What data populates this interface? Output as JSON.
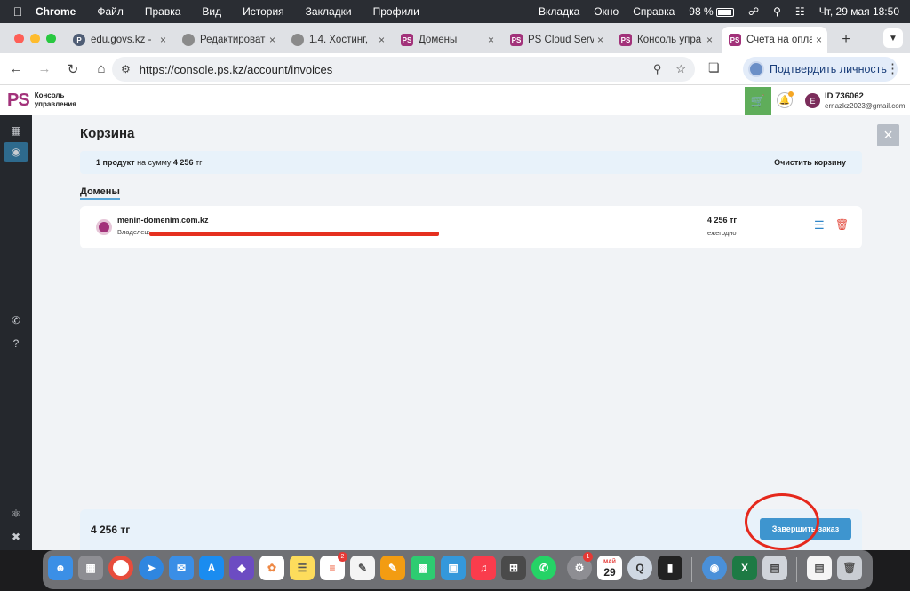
{
  "menubar": {
    "apple_icon": "apple-icon",
    "app": "Chrome",
    "items": [
      "Файл",
      "Правка",
      "Вид",
      "История",
      "Закладки",
      "Профили"
    ],
    "right_items": [
      "Вкладка",
      "Окно",
      "Справка"
    ],
    "battery": "98 %",
    "datetime": "Чт, 29 мая  18:50"
  },
  "tabs": [
    {
      "icon": "p",
      "title": "edu.govs.kz - ",
      "active": false
    },
    {
      "icon": "globe",
      "title": "Редактироват",
      "active": false
    },
    {
      "icon": "globe",
      "title": "1.4. Хостинг, ",
      "active": false
    },
    {
      "icon": "ps",
      "title": "Домены",
      "active": false
    },
    {
      "icon": "ps",
      "title": "PS Cloud Serv",
      "active": false
    },
    {
      "icon": "ps",
      "title": "Консоль упра",
      "active": false
    },
    {
      "icon": "ps",
      "title": "Счета на опла",
      "active": true
    }
  ],
  "toolbar": {
    "url": "https://console.ps.kz/account/invoices",
    "verify_label": "Подтвердить личность"
  },
  "app": {
    "logo": "PS",
    "console_title": "Консоль управления",
    "user_initial": "E",
    "user_id": "ID 736062",
    "user_email": "ernazkz2023@gmail.com"
  },
  "cart": {
    "title": "Корзина",
    "summary_count": "1 продукт",
    "summary_mid": " на сумму ",
    "summary_sum": "4 256",
    "summary_currency": " тг",
    "clear_label": "Очистить корзину",
    "section": "Домены",
    "items": [
      {
        "domain": "menin-domenim.com.kz",
        "owner_label": "Владелец:",
        "price": "4 256 тг",
        "period": "ежегодно"
      }
    ],
    "total": "4 256 тг",
    "finish_label": "Завершить заказ"
  },
  "dock": {
    "reminders_badge": "2",
    "settings_badge": "1",
    "calendar_month": "МАЙ",
    "calendar_day": "29"
  }
}
